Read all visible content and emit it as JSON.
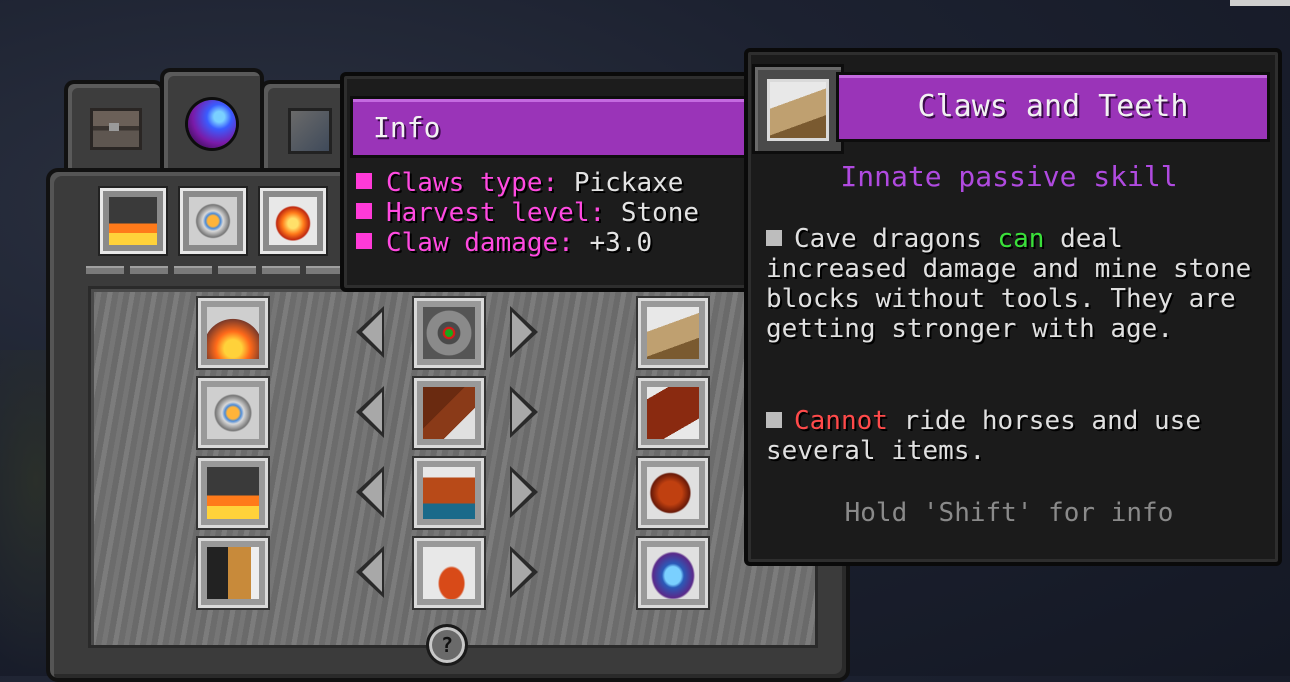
{
  "tabs": [
    {
      "icon": "chest-icon"
    },
    {
      "icon": "dragon-orb-icon"
    },
    {
      "icon": "book-icon"
    }
  ],
  "top_abilities": [
    {
      "icon": "lava-smoke-icon"
    },
    {
      "icon": "fire-shield-icon"
    },
    {
      "icon": "flame-icon"
    }
  ],
  "grid": {
    "left_column": [
      "fire-shard-icon",
      "fire-shield-icon",
      "lava-smoke-icon",
      "scroll-icon"
    ],
    "center_column": [
      "diamond-rune-icon",
      "dragon-leg-icon",
      "dragon-body-icon",
      "dragon-claw-icon"
    ],
    "right_column": [
      "pickaxe-claw-icon",
      "dragon-wing-icon",
      "dragon-head-icon",
      "water-drop-icon"
    ]
  },
  "info_tooltip": {
    "title": "Info",
    "lines": [
      {
        "label": "Claws type:",
        "value": "Pickaxe"
      },
      {
        "label": "Harvest level:",
        "value": "Stone"
      },
      {
        "label": "Claw damage:",
        "value": "+3.0"
      }
    ]
  },
  "skill_tooltip": {
    "title": "Claws and Teeth",
    "subtitle": "Innate passive skill",
    "desc1_pre": "Cave dragons ",
    "desc1_highlight": "can",
    "desc1_post": " deal increased damage and mine stone blocks without tools. They are getting stronger with age.",
    "desc2_highlight": "Cannot",
    "desc2_post": " ride horses and use several items.",
    "hint": "Hold 'Shift' for info"
  },
  "help_button": "?",
  "colors": {
    "header_purple": "#9a34b8",
    "bullet_magenta": "#ff3ad8",
    "positive_green": "#3ae03a",
    "negative_red": "#ff4a4a"
  }
}
